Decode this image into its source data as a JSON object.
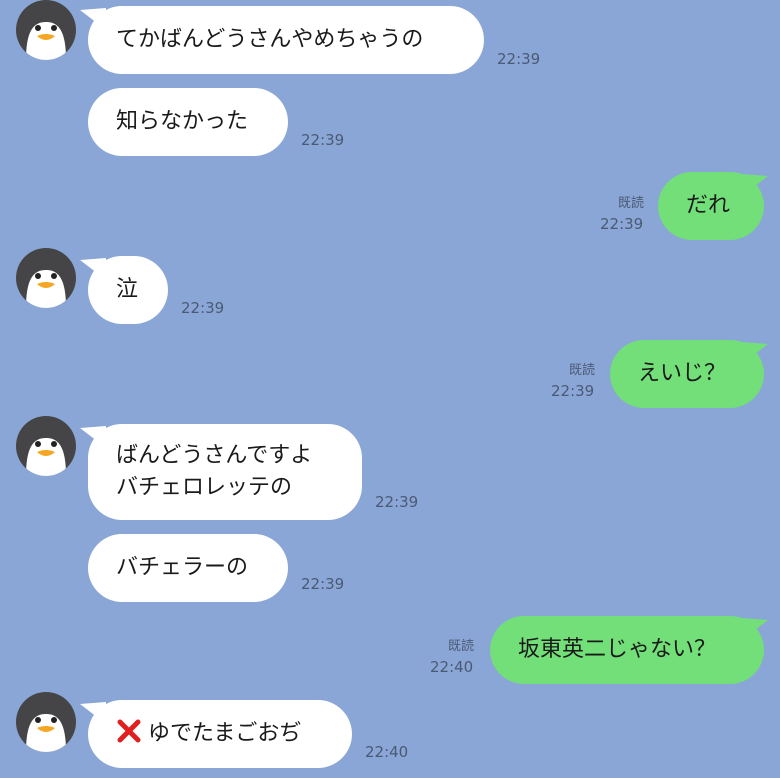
{
  "colors": {
    "background": "#8aa6d6",
    "incoming_bubble": "#ffffff",
    "outgoing_bubble": "#72df78",
    "meta_text": "#4b5a74"
  },
  "icons": {
    "avatar": "penguin-avatar-icon",
    "mistake": "red-x-icon"
  },
  "messages": [
    {
      "sender": "other",
      "text": "てかばんどうさんやめちゃうの",
      "time": "22:39"
    },
    {
      "sender": "other",
      "text": "知らなかった",
      "time": "22:39"
    },
    {
      "sender": "me",
      "text": "だれ",
      "time": "22:39",
      "read": "既読"
    },
    {
      "sender": "other",
      "text": "泣",
      "time": "22:39"
    },
    {
      "sender": "me",
      "text": "えいじ？",
      "time": "22:39",
      "read": "既読"
    },
    {
      "sender": "other",
      "lines": [
        "ばんどうさんですよ",
        "バチェロレッテの"
      ],
      "time": "22:39"
    },
    {
      "sender": "other",
      "text": "バチェラーの",
      "time": "22:39"
    },
    {
      "sender": "me",
      "text": "坂東英二じゃない？",
      "time": "22:40",
      "read": "既読"
    },
    {
      "sender": "other",
      "text": "ゆでたまごおぢ",
      "time": "22:40"
    }
  ]
}
